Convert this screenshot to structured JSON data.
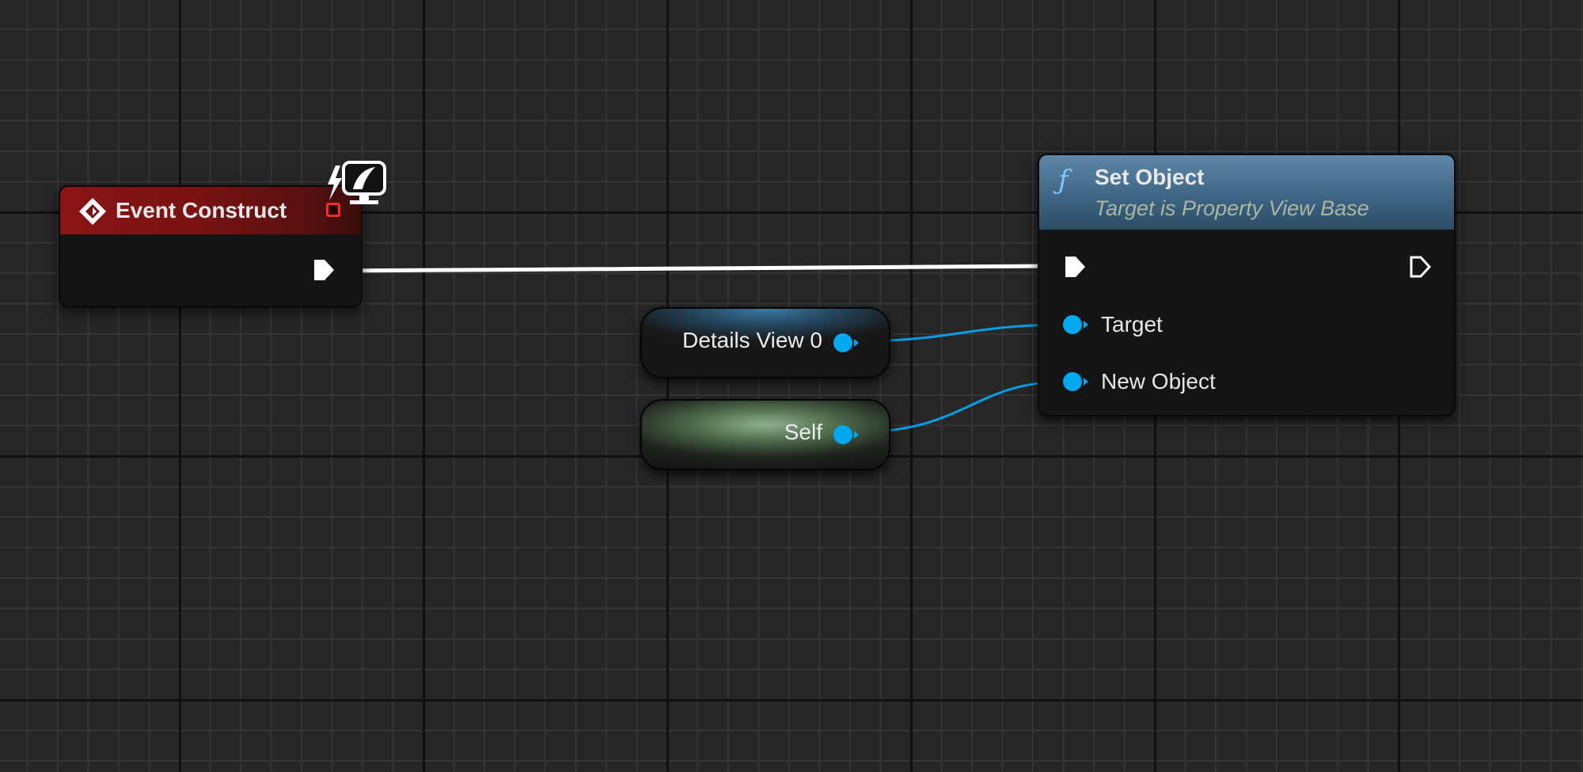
{
  "graph": {
    "event_node": {
      "title": "Event Construct"
    },
    "function_node": {
      "glyph": "ƒ",
      "title": "Set Object",
      "subtitle": "Target is Property View Base",
      "pins": {
        "target": "Target",
        "new_object": "New Object"
      }
    },
    "variables": {
      "details_view": "Details View 0",
      "self": "Self"
    }
  },
  "colors": {
    "exec_wire": "#ffffff",
    "object_pin": "#00a8f0",
    "event_header": "#8a1414",
    "function_header": "#4d7597"
  }
}
